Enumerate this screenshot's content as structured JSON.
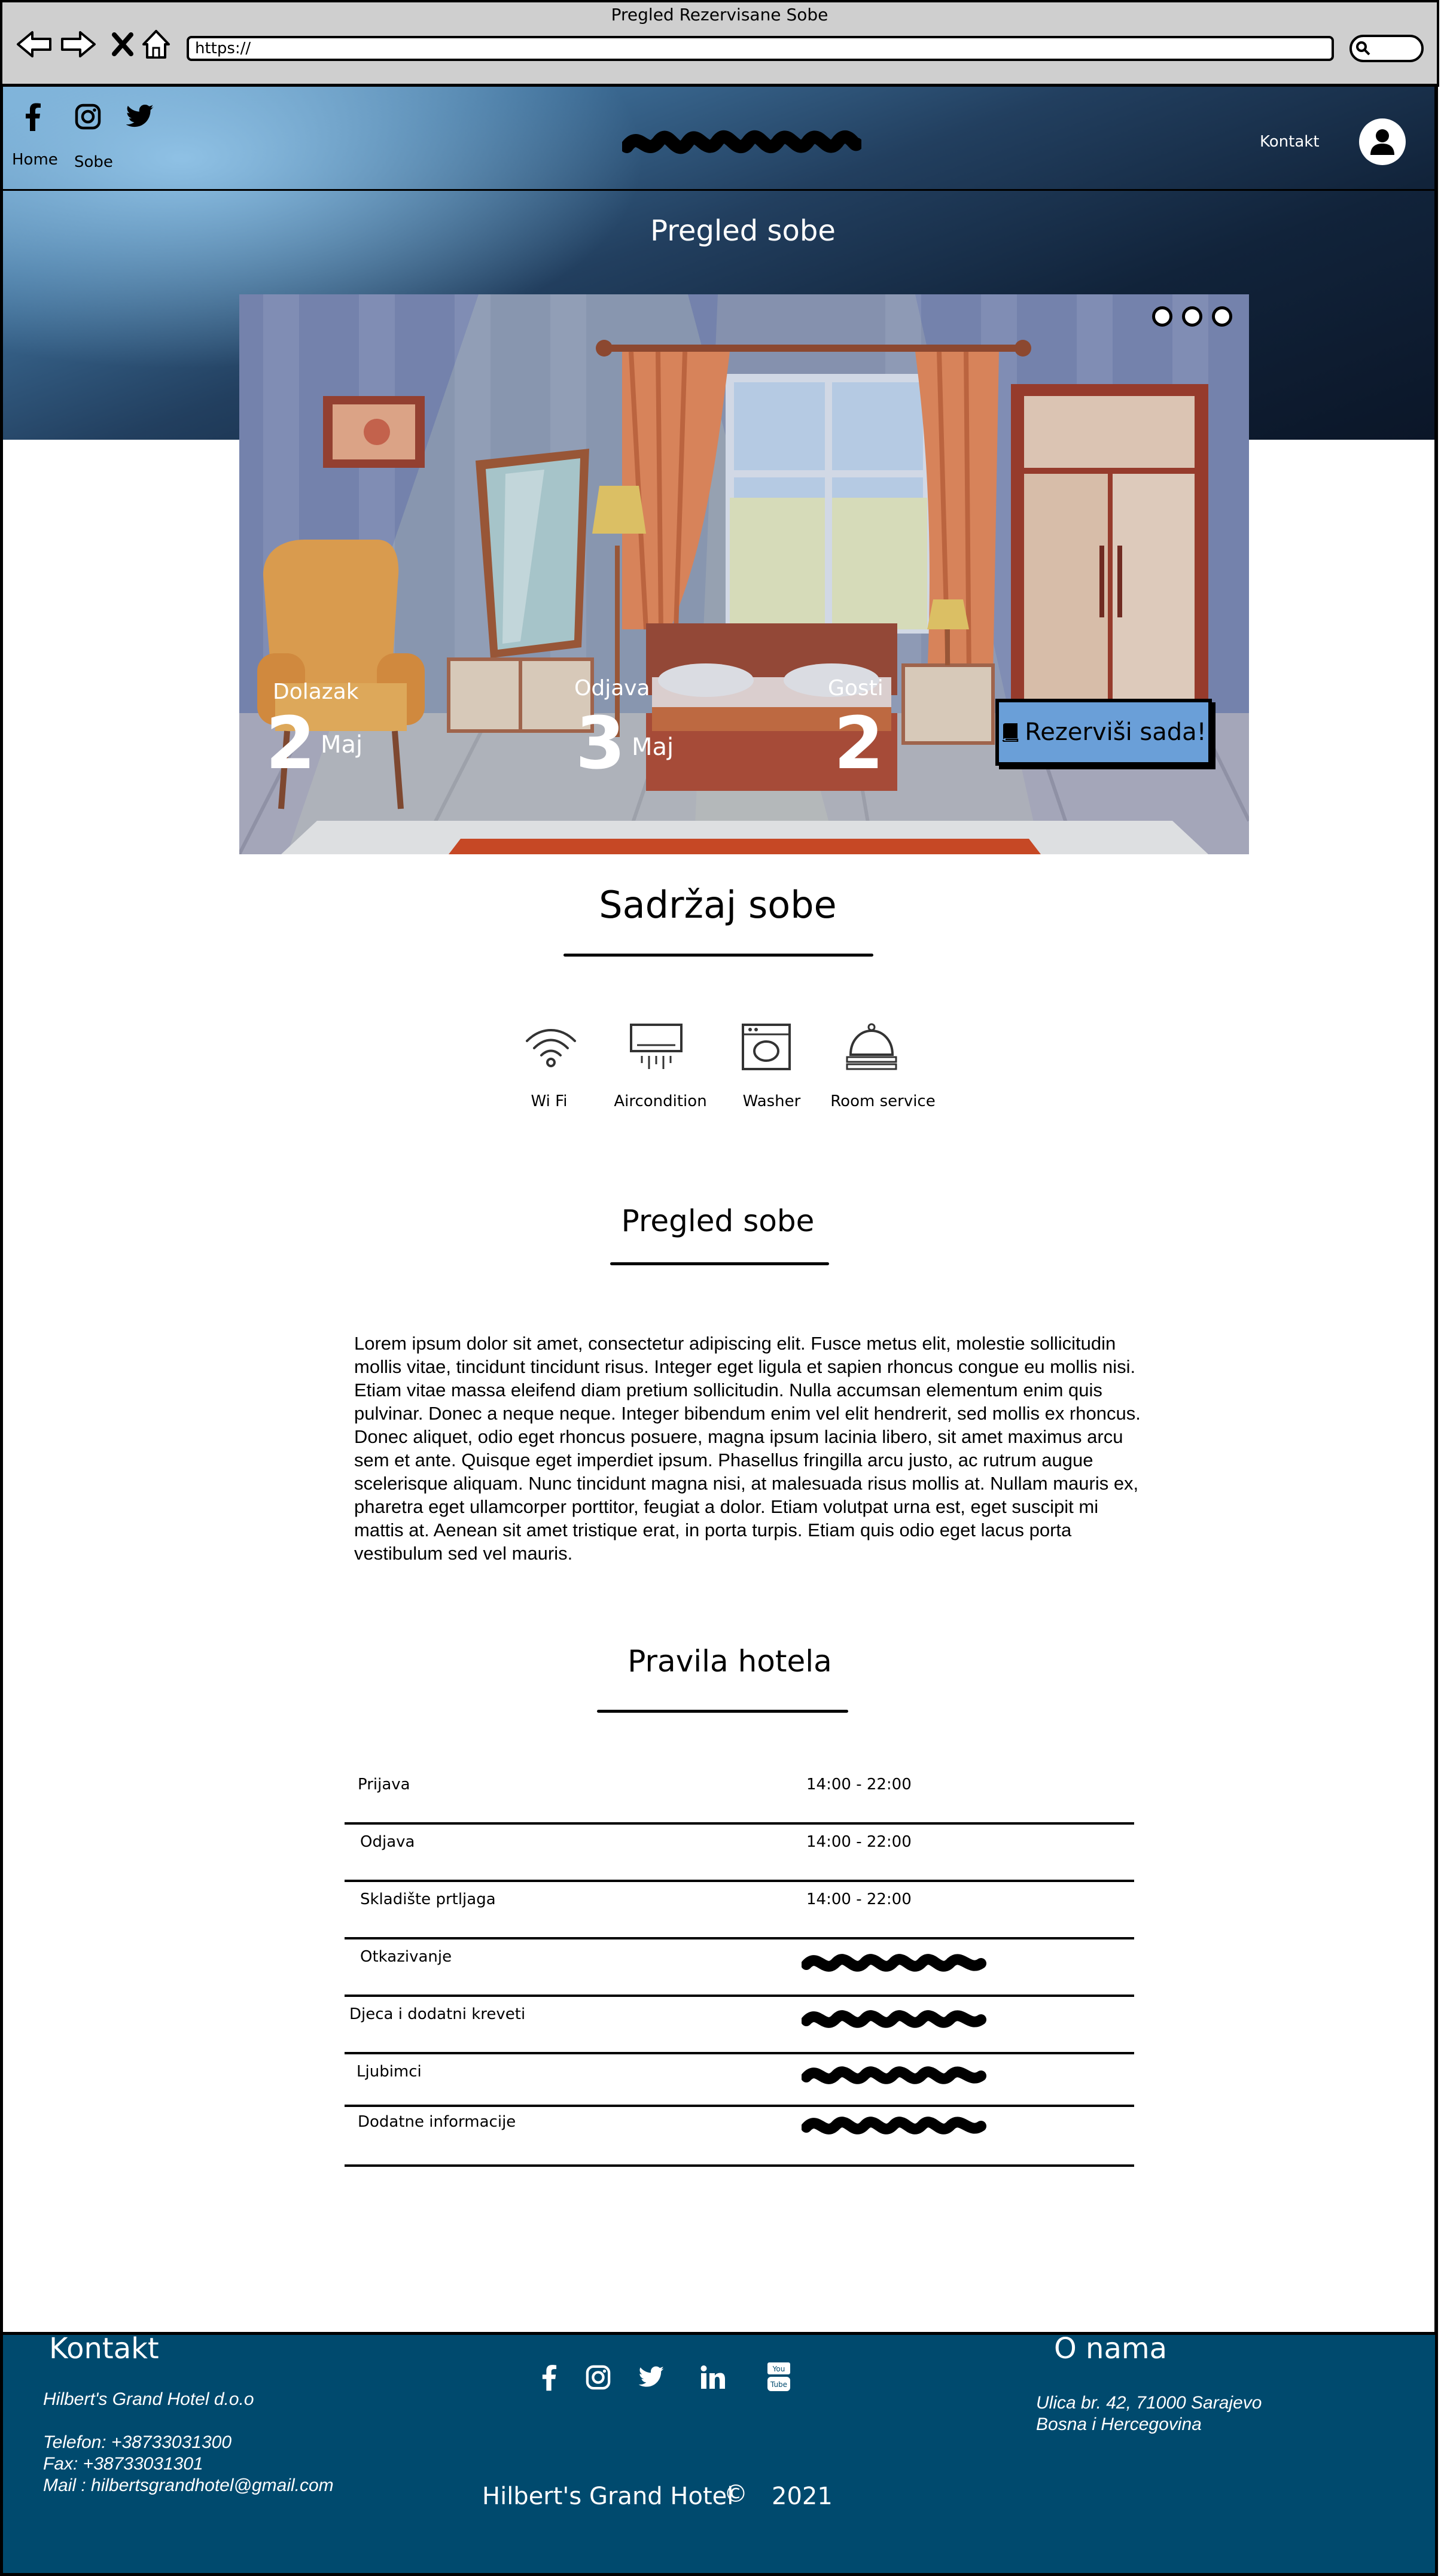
{
  "browser": {
    "window_title": "Pregled Rezervisane Sobe",
    "url": "https://"
  },
  "header": {
    "nav": {
      "home": "Home",
      "rooms": "Sobe",
      "contact": "Kontakt"
    },
    "social_icons": [
      "facebook-icon",
      "instagram-icon",
      "twitter-icon"
    ],
    "hero_title": "Pregled sobe"
  },
  "booking": {
    "arrival_label": "Dolazak",
    "arrival_day": "2",
    "arrival_month": "Maj",
    "departure_label": "Odjava",
    "departure_day": "3",
    "departure_month": "Maj",
    "guests_label": "Gosti",
    "guests_count": "2",
    "book_button": "Rezerviši sada!"
  },
  "amenities": {
    "title": "Sadržaj sobe",
    "items": [
      {
        "label": "Wi Fi",
        "icon": "wifi-icon"
      },
      {
        "label": "Aircondition",
        "icon": "aircondition-icon"
      },
      {
        "label": "Washer",
        "icon": "washer-icon"
      },
      {
        "label": "Room service",
        "icon": "room-service-icon"
      }
    ]
  },
  "overview": {
    "title": "Pregled sobe",
    "text": "Lorem ipsum dolor sit amet, consectetur adipiscing elit. Fusce metus elit, molestie sollicitudin mollis vitae, tincidunt tincidunt risus. Integer eget ligula et sapien rhoncus congue eu mollis nisi. Etiam vitae massa eleifend diam pretium sollicitudin. Nulla accumsan elementum enim quis pulvinar. Donec a neque neque. Integer bibendum enim vel elit hendrerit, sed mollis ex rhoncus. Donec aliquet, odio eget rhoncus posuere, magna ipsum lacinia libero, sit amet maximus arcu sem et ante. Quisque eget imperdiet ipsum. Phasellus fringilla arcu justo, ac rutrum augue scelerisque aliquam. Nunc tincidunt magna nisi, at malesuada risus mollis at. Nullam mauris ex, pharetra eget ullamcorper porttitor, feugiat a dolor. Etiam volutpat urna est, eget suscipit mi mattis at. Aenean sit amet tristique erat, in porta turpis. Etiam quis odio eget lacus porta vestibulum sed vel mauris."
  },
  "rules": {
    "title": "Pravila hotela",
    "rows": [
      {
        "label": "Prijava",
        "value": "14:00 - 22:00"
      },
      {
        "label": "Odjava",
        "value": "14:00 - 22:00"
      },
      {
        "label": "Skladište prtljaga",
        "value": "14:00 - 22:00"
      },
      {
        "label": "Otkazivanje",
        "value": ""
      },
      {
        "label": "Djeca i dodatni kreveti",
        "value": ""
      },
      {
        "label": "Ljubimci",
        "value": ""
      },
      {
        "label": "Dodatne informacije",
        "value": ""
      }
    ]
  },
  "footer": {
    "contact_title": "Kontakt",
    "company": "Hilbert's Grand Hotel d.o.o",
    "phone": "Telefon: +38733031300",
    "fax": "Fax: +38733031301",
    "mail": "Mail : hilbertsgrandhotel@gmail.com",
    "about_title": "O nama",
    "address_line1": "Ulica br. 42, 71000 Sarajevo",
    "address_line2": "Bosna i Hercegovina",
    "brand": "Hilbert's Grand Hotel",
    "copyright_symbol": "©",
    "year": "2021",
    "social_icons": [
      "facebook-icon",
      "instagram-icon",
      "twitter-icon",
      "linkedin-icon",
      "youtube-icon"
    ]
  },
  "colors": {
    "footer_bg": "#004a6e",
    "book_button": "#6a9fd8",
    "browser_chrome": "#cfcfcf"
  }
}
